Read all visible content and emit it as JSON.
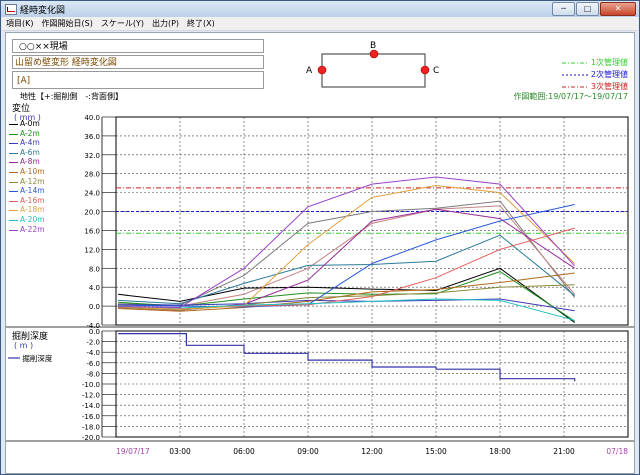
{
  "window": {
    "title": "経時変化図",
    "controls": [
      "─",
      "□",
      "✕"
    ]
  },
  "menu": [
    "項目(K)",
    "作図開始日(S)",
    "スケール(Y)",
    "出力(P)",
    "終了(X)"
  ],
  "header": {
    "site": "○○××現場",
    "subtitle": "山留め壁変形 経時変化図",
    "section": "[A]",
    "wall": {
      "point_a": "A",
      "point_b": "B",
      "point_c": "C"
    },
    "legend_mgmt": [
      {
        "label": "1次管理値",
        "color": "#33cc33"
      },
      {
        "label": "2次管理値",
        "color": "#1a1ad0"
      },
      {
        "label": "3次管理値",
        "color": "#cc2222"
      }
    ],
    "direction_note": "地性【+:掘削側　-:背面側】",
    "date_range": "作図範囲:19/07/17～19/07/17"
  },
  "chart_data": [
    {
      "type": "line",
      "ylabel": "変位",
      "yunit": "( mm )",
      "ylim": [
        -4.0,
        40.0
      ],
      "yticks": [
        "40.0",
        "36.0",
        "32.0",
        "28.0",
        "24.0",
        "20.0",
        "16.0",
        "12.0",
        "8.0",
        "4.0",
        "0.0",
        "-4.0"
      ],
      "xlim": [
        0,
        24
      ],
      "grid": true,
      "thresholds": [
        {
          "name": "1次管理値",
          "value": 15.4,
          "color": "#33cc33",
          "style": "dashdot"
        },
        {
          "name": "2次管理値",
          "value": 20.0,
          "color": "#1a1ad0",
          "style": "dashed"
        },
        {
          "name": "3次管理値",
          "value": 25.0,
          "color": "#cc2222",
          "style": "dashdot"
        }
      ],
      "series": [
        {
          "name": "A-0m",
          "color": "#000000",
          "points": [
            [
              0.1,
              2.5
            ],
            [
              3,
              1.0
            ],
            [
              6,
              3.8
            ],
            [
              9,
              4.0
            ],
            [
              12,
              3.6
            ],
            [
              15,
              3.3
            ],
            [
              18,
              8.0
            ],
            [
              21.5,
              -3.5
            ]
          ]
        },
        {
          "name": "A-2m",
          "color": "#1f8f1f",
          "points": [
            [
              0.1,
              0.8
            ],
            [
              3,
              0.0
            ],
            [
              6,
              1.5
            ],
            [
              9,
              2.8
            ],
            [
              12,
              2.5
            ],
            [
              15,
              2.6
            ],
            [
              18,
              7.3
            ],
            [
              21.5,
              -3.2
            ]
          ]
        },
        {
          "name": "A-4m",
          "color": "#3a3ab8",
          "points": [
            [
              0.1,
              0.3
            ],
            [
              3,
              0.2
            ],
            [
              6,
              0.5
            ],
            [
              9,
              1.2
            ],
            [
              12,
              1.0
            ],
            [
              15,
              1.2
            ],
            [
              18,
              1.5
            ],
            [
              21.5,
              -1.0
            ]
          ]
        },
        {
          "name": "A-6m",
          "color": "#2a7a9a",
          "points": [
            [
              0.1,
              1.2
            ],
            [
              3,
              0.5
            ],
            [
              6,
              4.8
            ],
            [
              9,
              8.6
            ],
            [
              12,
              8.8
            ],
            [
              15,
              9.5
            ],
            [
              18,
              15.0
            ],
            [
              21.5,
              2.2
            ]
          ]
        },
        {
          "name": "A-8m",
          "color": "#9a2a9a",
          "points": [
            [
              0.1,
              -0.3
            ],
            [
              3,
              -0.9
            ],
            [
              6,
              0.4
            ],
            [
              9,
              5.5
            ],
            [
              12,
              18.0
            ],
            [
              15,
              20.5
            ],
            [
              18,
              18.5
            ],
            [
              21.5,
              8.0
            ]
          ]
        },
        {
          "name": "A-10m",
          "color": "#b06a1a",
          "points": [
            [
              0.1,
              -0.5
            ],
            [
              3,
              -1.1
            ],
            [
              6,
              -0.3
            ],
            [
              9,
              1.0
            ],
            [
              12,
              3.0
            ],
            [
              15,
              3.5
            ],
            [
              18,
              5.0
            ],
            [
              21.5,
              7.0
            ]
          ]
        },
        {
          "name": "A-12m",
          "color": "#8a8a3a",
          "points": [
            [
              0.1,
              -0.3
            ],
            [
              3,
              -0.8
            ],
            [
              6,
              0.2
            ],
            [
              9,
              1.8
            ],
            [
              12,
              2.2
            ],
            [
              15,
              2.8
            ],
            [
              18,
              4.0
            ],
            [
              21.5,
              4.5
            ]
          ]
        },
        {
          "name": "A-14m",
          "color": "#2a5ad8",
          "points": [
            [
              0.1,
              0.2
            ],
            [
              3,
              0.0
            ],
            [
              6,
              -0.2
            ],
            [
              9,
              0.3
            ],
            [
              12,
              9.0
            ],
            [
              15,
              14.0
            ],
            [
              18,
              18.0
            ],
            [
              21.5,
              21.5
            ]
          ]
        },
        {
          "name": "A-16m",
          "color": "#e06060",
          "points": [
            [
              0.1,
              0.1
            ],
            [
              3,
              -0.5
            ],
            [
              6,
              0.0
            ],
            [
              9,
              0.3
            ],
            [
              12,
              2.0
            ],
            [
              15,
              6.0
            ],
            [
              18,
              12.0
            ],
            [
              21.5,
              16.5
            ]
          ]
        },
        {
          "name": "A-18m",
          "color": "#e0a040",
          "points": [
            [
              0.1,
              -0.2
            ],
            [
              3,
              -0.7
            ],
            [
              6,
              0.1
            ],
            [
              9,
              13.0
            ],
            [
              12,
              23.0
            ],
            [
              15,
              25.5
            ],
            [
              18,
              24.0
            ],
            [
              21.5,
              9.0
            ]
          ]
        },
        {
          "name": "A-20m",
          "color": "#20c0c0",
          "points": [
            [
              0.1,
              0.0
            ],
            [
              3,
              -0.4
            ],
            [
              6,
              0.2
            ],
            [
              9,
              0.5
            ],
            [
              12,
              1.0
            ],
            [
              15,
              1.5
            ],
            [
              18,
              1.2
            ],
            [
              21.5,
              -3.0
            ]
          ]
        },
        {
          "name": "A-22m",
          "color": "#9a40c8",
          "points": [
            [
              0.1,
              -0.1
            ],
            [
              3,
              -0.3
            ],
            [
              6,
              8.0
            ],
            [
              9,
              21.0
            ],
            [
              12,
              25.8
            ],
            [
              15,
              27.3
            ],
            [
              18,
              25.8
            ],
            [
              21.5,
              8.5
            ]
          ]
        }
      ],
      "extra_lines": [
        {
          "color": "#7a7a7a",
          "points": [
            [
              0.1,
              0.5
            ],
            [
              3,
              0.2
            ],
            [
              6,
              6.5
            ],
            [
              9,
              17.5
            ],
            [
              12,
              20.0
            ],
            [
              15,
              20.7
            ],
            [
              18,
              22.2
            ],
            [
              21.5,
              1.8
            ]
          ]
        },
        {
          "color": "#c08080",
          "points": [
            [
              0.1,
              0.3
            ],
            [
              3,
              0.0
            ],
            [
              6,
              2.5
            ],
            [
              9,
              8.0
            ],
            [
              12,
              17.5
            ],
            [
              15,
              20.5
            ],
            [
              18,
              21.2
            ],
            [
              21.5,
              2.5
            ]
          ]
        }
      ]
    },
    {
      "type": "line",
      "ylabel": "掘削深度",
      "yunit": "( m )",
      "ylim": [
        -20.0,
        0.0
      ],
      "yticks": [
        "0.0",
        "-2.0",
        "-4.0",
        "-6.0",
        "-8.0",
        "-10.0",
        "-12.0",
        "-14.0",
        "-16.0",
        "-18.0",
        "-20.0"
      ],
      "xlim": [
        0,
        24
      ],
      "grid": true,
      "series": [
        {
          "name": "掘削深度",
          "color": "#3333aa",
          "step": true,
          "points": [
            [
              0.1,
              -0.5
            ],
            [
              3.3,
              -0.5
            ],
            [
              3.3,
              -2.7
            ],
            [
              6,
              -2.7
            ],
            [
              6,
              -4.2
            ],
            [
              9,
              -4.2
            ],
            [
              9,
              -5.5
            ],
            [
              12,
              -5.5
            ],
            [
              12,
              -6.8
            ],
            [
              15,
              -6.8
            ],
            [
              15,
              -7.2
            ],
            [
              18,
              -7.2
            ],
            [
              18,
              -9.0
            ],
            [
              21.5,
              -9.0
            ],
            [
              21.5,
              -9.5
            ]
          ]
        }
      ]
    }
  ],
  "xaxis": {
    "ticks": [
      "19/07/17",
      "03:00",
      "06:00",
      "09:00",
      "12:00",
      "15:00",
      "18:00",
      "21:00",
      "07/18"
    ],
    "date_color": "#aa44aa"
  }
}
